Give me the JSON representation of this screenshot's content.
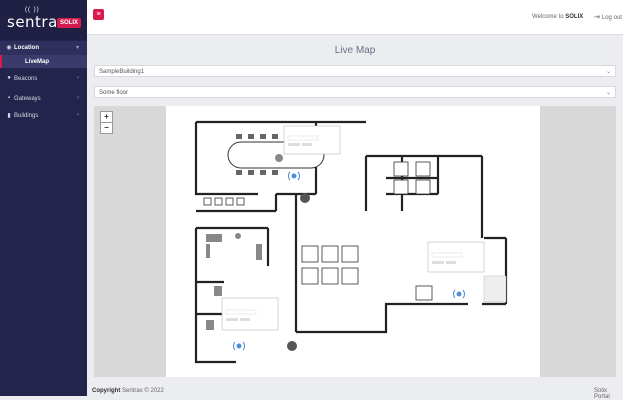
{
  "brand": {
    "logo_text": "sentrax",
    "badge": "SOLIX",
    "logo_mark": "(( ))"
  },
  "sidebar": {
    "items": [
      {
        "label": "Location",
        "icon": "globe-icon"
      },
      {
        "label": "Beacons",
        "icon": "beacon-icon"
      },
      {
        "label": "Gateways",
        "icon": "gateway-icon"
      },
      {
        "label": "Buildings",
        "icon": "building-icon"
      }
    ],
    "sub_item": "LiveMap"
  },
  "topbar": {
    "menu_icon": "≡",
    "welcome_prefix": "Welcome to ",
    "welcome_user": "SOLIX",
    "logout": "Log out"
  },
  "main": {
    "title": "Live Map",
    "building_select": "SampleBuilding1",
    "floor_select": "Some floor",
    "zoom_in": "+",
    "zoom_out": "−"
  },
  "footer": {
    "copyright_bold": "Copyright",
    "copyright_rest": " Sentrax © 2022",
    "portal": "Solix Portal"
  },
  "colors": {
    "sidebar": "#23244b",
    "accent": "#d81b4f",
    "beacon": "#4f8fd8"
  }
}
